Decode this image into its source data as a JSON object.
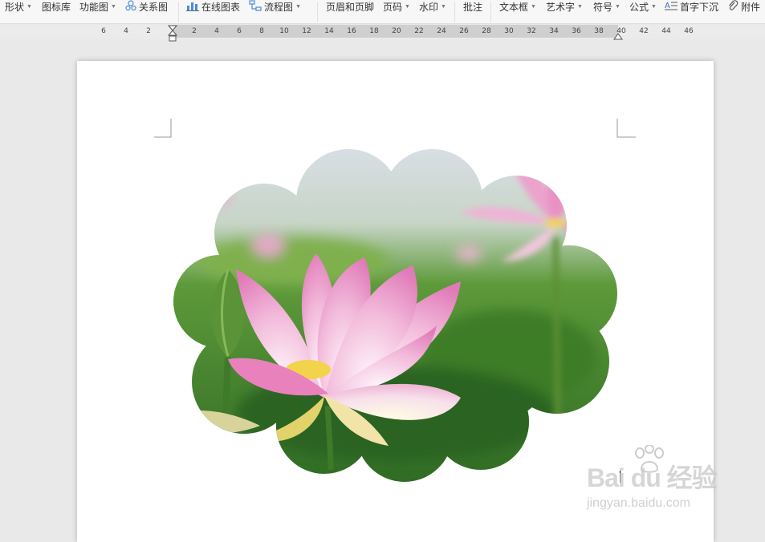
{
  "toolbar": {
    "items": [
      {
        "label": "形状",
        "icon": "",
        "dropdown": true
      },
      {
        "label": "图标库",
        "icon": "",
        "dropdown": false
      },
      {
        "label": "功能图",
        "icon": "",
        "dropdown": true
      },
      {
        "label": "关系图",
        "icon": "relationship-icon",
        "dropdown": false
      },
      {
        "label": "在线图表",
        "icon": "online-chart-icon",
        "dropdown": false
      },
      {
        "label": "流程图",
        "icon": "flowchart-icon",
        "dropdown": true
      },
      {
        "label": "页眉和页脚",
        "icon": "",
        "dropdown": false
      },
      {
        "label": "页码",
        "icon": "",
        "dropdown": true
      },
      {
        "label": "水印",
        "icon": "",
        "dropdown": true
      },
      {
        "label": "批注",
        "icon": "",
        "dropdown": false
      },
      {
        "label": "文本框",
        "icon": "",
        "dropdown": true
      },
      {
        "label": "艺术字",
        "icon": "",
        "dropdown": true
      },
      {
        "label": "符号",
        "icon": "",
        "dropdown": true
      },
      {
        "label": "公式",
        "icon": "",
        "dropdown": true
      },
      {
        "label": "首字下沉",
        "icon": "drop-cap-icon",
        "dropdown": false
      },
      {
        "label": "附件",
        "icon": "paperclip-icon",
        "dropdown": false
      }
    ]
  },
  "ruler": {
    "labels": [
      "6",
      "4",
      "2",
      "2",
      "4",
      "6",
      "8",
      "10",
      "12",
      "14",
      "16",
      "18",
      "20",
      "22",
      "24",
      "26",
      "28",
      "30",
      "32",
      "34",
      "36",
      "38",
      "40",
      "42",
      "44",
      "46"
    ]
  },
  "watermark": {
    "brand": "Bai du 经验",
    "url": "jingyan.baidu.com"
  },
  "colors": {
    "toolbar_bg": "#f7f7f7",
    "workspace_bg": "#e9e9e9",
    "page_bg": "#ffffff",
    "lotus_pink": "#f2a6cf",
    "leaf_green": "#4e8a30"
  }
}
